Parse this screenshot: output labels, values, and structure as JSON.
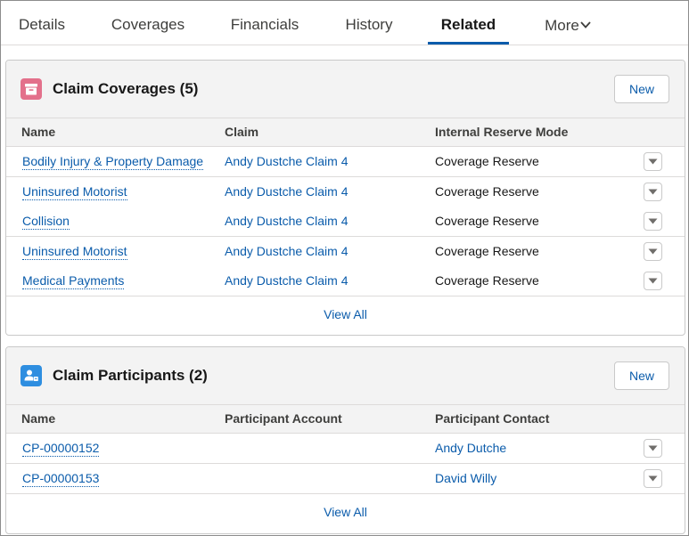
{
  "tabs": [
    {
      "label": "Details",
      "active": false
    },
    {
      "label": "Coverages",
      "active": false
    },
    {
      "label": "Financials",
      "active": false
    },
    {
      "label": "History",
      "active": false
    },
    {
      "label": "Related",
      "active": true
    },
    {
      "label": "More",
      "active": false
    }
  ],
  "colors": {
    "accent": "#0b5cab",
    "coverages_icon": "#e3708b",
    "participants_icon": "#2e8ee0"
  },
  "coverages": {
    "icon": "archive-icon",
    "title": "Claim Coverages (5)",
    "new_label": "New",
    "columns": [
      "Name",
      "Claim",
      "Internal Reserve Mode"
    ],
    "rows": [
      {
        "name": "Bodily Injury & Property Damage",
        "claim": "Andy Dustche Claim 4",
        "mode": "Coverage Reserve"
      },
      {
        "name": "Uninsured Motorist",
        "claim": "Andy Dustche Claim 4",
        "mode": "Coverage Reserve"
      },
      {
        "name": "Collision",
        "claim": "Andy Dustche Claim 4",
        "mode": "Coverage Reserve"
      },
      {
        "name": "Uninsured Motorist",
        "claim": "Andy Dustche Claim 4",
        "mode": "Coverage Reserve"
      },
      {
        "name": "Medical Payments",
        "claim": "Andy Dustche Claim 4",
        "mode": "Coverage Reserve"
      }
    ],
    "view_all": "View All"
  },
  "participants": {
    "icon": "participant-icon",
    "title": "Claim Participants (2)",
    "new_label": "New",
    "columns": [
      "Name",
      "Participant Account",
      "Participant Contact"
    ],
    "rows": [
      {
        "name": "CP-00000152",
        "account": "",
        "contact": "Andy Dutche"
      },
      {
        "name": "CP-00000153",
        "account": "",
        "contact": "David Willy"
      }
    ],
    "view_all": "View All"
  }
}
